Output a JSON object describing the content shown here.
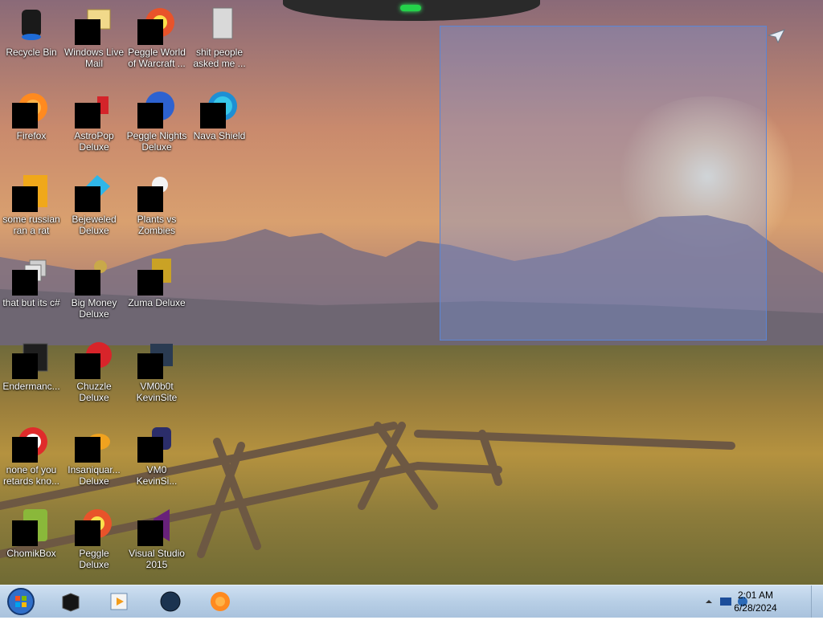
{
  "desktop": {
    "icons": [
      {
        "label": "Recycle Bin",
        "icon": "recycle-bin-icon"
      },
      {
        "label": "Windows Live Mail",
        "icon": "windows-live-mail-icon"
      },
      {
        "label": "Peggle World of Warcraft ...",
        "icon": "peggle-world-of-warcraft-icon"
      },
      {
        "label": "shit people asked me ...",
        "icon": "text-file-icon"
      },
      {
        "label": "Firefox",
        "icon": "firefox-icon"
      },
      {
        "label": "AstroPop Deluxe",
        "icon": "astropop-deluxe-icon"
      },
      {
        "label": "Peggle Nights Deluxe",
        "icon": "peggle-nights-icon"
      },
      {
        "label": "Nava Shield",
        "icon": "nava-shield-icon"
      },
      {
        "label": "some russian ran a rat",
        "icon": "yellow-app-icon"
      },
      {
        "label": "Bejeweled Deluxe",
        "icon": "bejeweled-deluxe-icon"
      },
      {
        "label": "Plants vs Zombies",
        "icon": "plants-vs-zombies-icon"
      },
      {
        "label": "that but its c#",
        "icon": "folder-stack-icon"
      },
      {
        "label": "Big Money Deluxe",
        "icon": "big-money-deluxe-icon"
      },
      {
        "label": "Zuma Deluxe",
        "icon": "zuma-deluxe-icon"
      },
      {
        "label": "Endermanc...",
        "icon": "console-app-icon"
      },
      {
        "label": "Chuzzle Deluxe",
        "icon": "chuzzle-deluxe-icon"
      },
      {
        "label": "VM0b0t KevinSite",
        "icon": "vm0b0t-icon"
      },
      {
        "label": "none of you retards kno...",
        "icon": "red-app-icon"
      },
      {
        "label": "Insaniquar... Deluxe",
        "icon": "insaniquarium-deluxe-icon"
      },
      {
        "label": "VM0 KevinSi...",
        "icon": "vm0-icon"
      },
      {
        "label": "ChomikBox",
        "icon": "chomikbox-icon"
      },
      {
        "label": "Peggle Deluxe",
        "icon": "peggle-deluxe-icon"
      },
      {
        "label": "Visual Studio 2015",
        "icon": "visual-studio-icon"
      }
    ]
  },
  "taskbar": {
    "start_icon": "windows-start-icon",
    "pinned": [
      {
        "icon": "black-cube-app-icon"
      },
      {
        "icon": "media-player-icon"
      },
      {
        "icon": "dark-globe-app-icon"
      },
      {
        "icon": "firefox-icon"
      }
    ],
    "tray": {
      "time": "2:01 AM",
      "date": "6/28/2024"
    }
  },
  "colors": {
    "taskbar": "#b8cfe6",
    "selection": "#5a86d6",
    "notch_led": "#24d24a"
  }
}
